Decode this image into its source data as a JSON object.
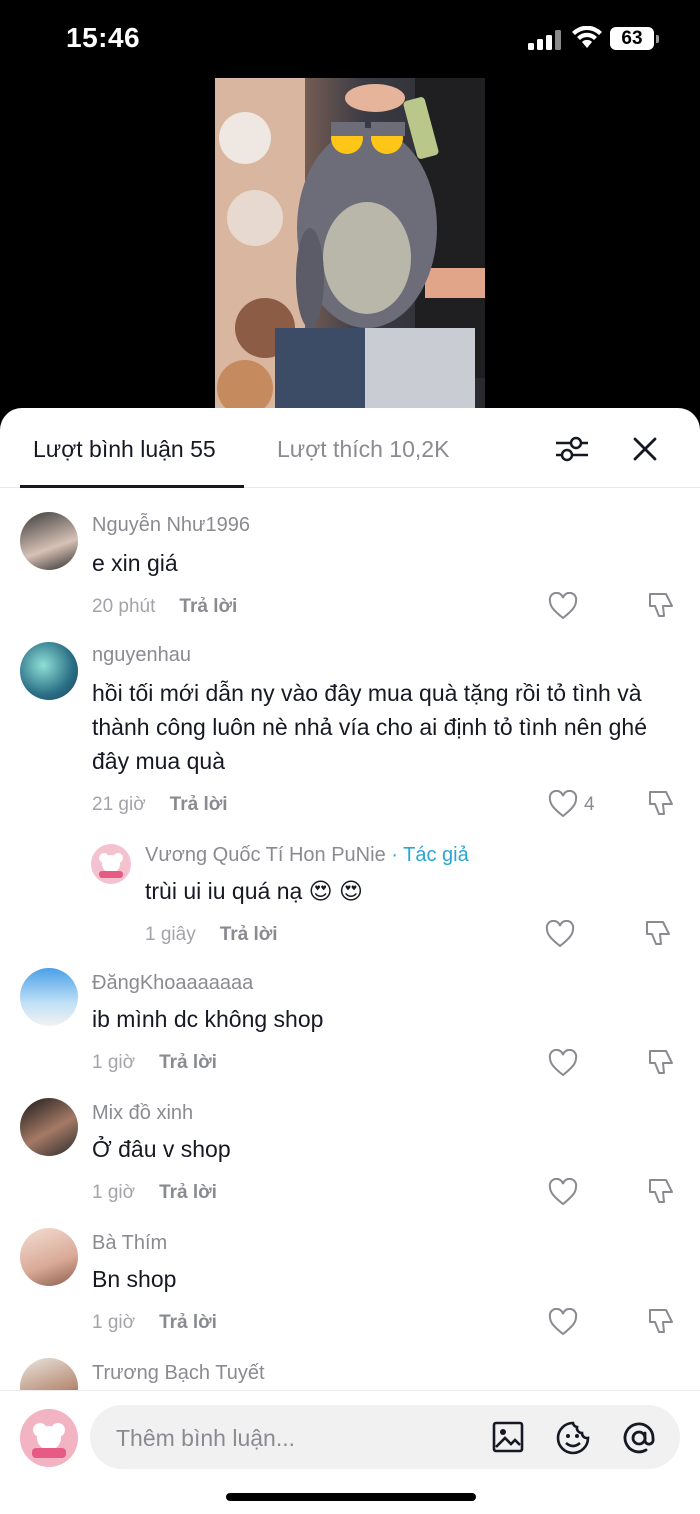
{
  "status_bar": {
    "time": "15:46",
    "battery": "63"
  },
  "tabs": {
    "comments_label": "Lượt bình luận 55",
    "likes_label": "Lượt thích 10,2K"
  },
  "comments": [
    {
      "name": "Nguyễn Như1996",
      "text": "e xin giá",
      "time": "20 phút",
      "reply": "Trả lời",
      "likes": ""
    },
    {
      "name": "nguyenhau",
      "text": "hồi tối mới dẫn ny vào đây mua quà tặng rồi tỏ tình và thành công luôn nè nhả vía cho ai định tỏ tình nên ghé đây mua quà",
      "time": "21 giờ",
      "reply": "Trả lời",
      "likes": "4"
    },
    {
      "name": "Vương Quốc Tí Hon PuNie",
      "author_tag": " · Tác giả",
      "text": "trùi ui iu quá nạ 😍 😍",
      "time": "1 giây",
      "reply": "Trả lời",
      "likes": ""
    },
    {
      "name": "ĐăngKhoaaaaaaa",
      "text": "ib mình dc không shop",
      "time": "1 giờ",
      "reply": "Trả lời",
      "likes": ""
    },
    {
      "name": "Mix đồ xinh",
      "text": "Ở đâu v shop",
      "time": "1 giờ",
      "reply": "Trả lời",
      "likes": ""
    },
    {
      "name": "Bà Thím",
      "text": "Bn shop",
      "time": "1 giờ",
      "reply": "Trả lời",
      "likes": ""
    },
    {
      "name": "Trương Bạch Tuyết",
      "text": "",
      "time": "",
      "reply": "",
      "likes": ""
    }
  ],
  "input": {
    "placeholder": "Thêm bình luận..."
  },
  "icons": [
    "signal-icon",
    "wifi-icon",
    "battery-icon",
    "filter-icon",
    "close-icon",
    "heart-icon",
    "dislike-icon",
    "image-icon",
    "emoji-icon",
    "at-icon"
  ],
  "colors": {
    "author_tag": "#2aa5d4",
    "text": "#161823",
    "muted": "#8a8b91"
  }
}
